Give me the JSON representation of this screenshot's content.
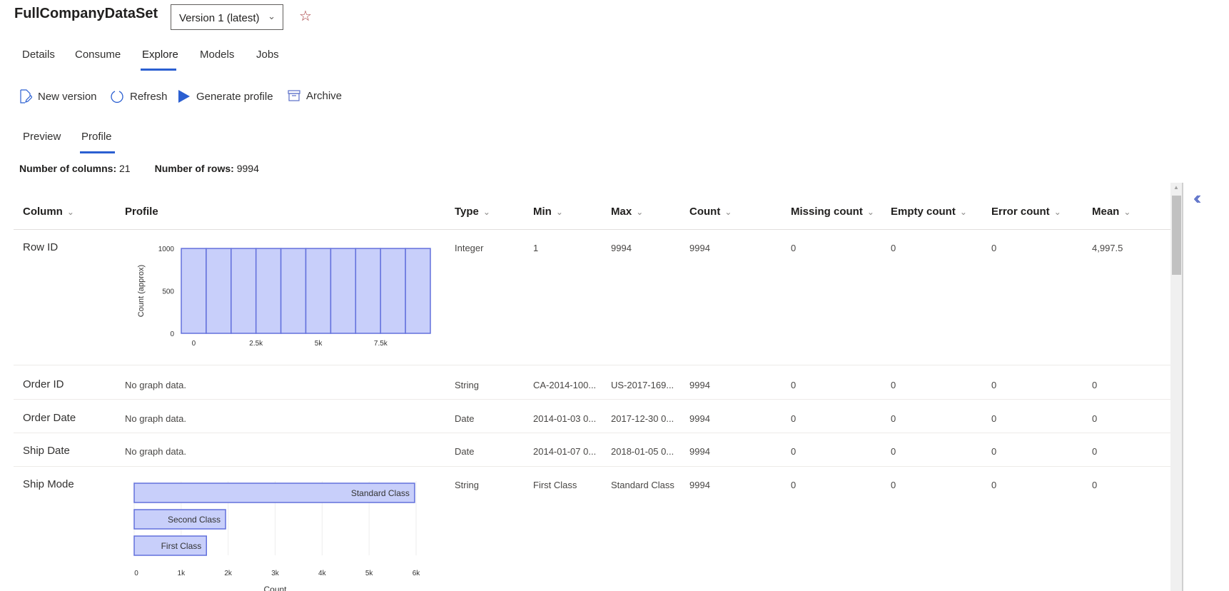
{
  "header": {
    "title": "FullCompanyDataSet",
    "version": "Version 1 (latest)"
  },
  "tabs": [
    "Details",
    "Consume",
    "Explore",
    "Models",
    "Jobs"
  ],
  "active_tab": "Explore",
  "toolbar": {
    "new_version": "New version",
    "refresh": "Refresh",
    "generate_profile": "Generate profile",
    "archive": "Archive"
  },
  "subtabs": [
    "Preview",
    "Profile"
  ],
  "active_subtab": "Profile",
  "stats": {
    "columns_label": "Number of columns:",
    "columns": "21",
    "rows_label": "Number of rows:",
    "rows": "9994"
  },
  "table": {
    "headers": [
      "Column",
      "Profile",
      "Type",
      "Min",
      "Max",
      "Count",
      "Missing count",
      "Empty count",
      "Error count",
      "Mean"
    ],
    "rows": [
      {
        "column": "Row ID",
        "profile": "",
        "type": "Integer",
        "min": "1",
        "max": "9994",
        "count": "9994",
        "missing": "0",
        "empty": "0",
        "error": "0",
        "mean": "4,997.5"
      },
      {
        "column": "Order ID",
        "profile": "No graph data.",
        "type": "String",
        "min": "CA-2014-100...",
        "max": "US-2017-169...",
        "count": "9994",
        "missing": "0",
        "empty": "0",
        "error": "0",
        "mean": "0"
      },
      {
        "column": "Order Date",
        "profile": "No graph data.",
        "type": "Date",
        "min": "2014-01-03 0...",
        "max": "2017-12-30 0...",
        "count": "9994",
        "missing": "0",
        "empty": "0",
        "error": "0",
        "mean": "0"
      },
      {
        "column": "Ship Date",
        "profile": "No graph data.",
        "type": "Date",
        "min": "2014-01-07 0...",
        "max": "2018-01-05 0...",
        "count": "9994",
        "missing": "0",
        "empty": "0",
        "error": "0",
        "mean": "0"
      },
      {
        "column": "Ship Mode",
        "profile": "",
        "type": "String",
        "min": "First Class",
        "max": "Standard Class",
        "count": "9994",
        "missing": "0",
        "empty": "0",
        "error": "0",
        "mean": "0"
      }
    ]
  },
  "chart_data": [
    {
      "type": "bar",
      "title": "Row ID histogram",
      "ylabel": "Count (approx)",
      "xlabel": "",
      "bin_start": -499,
      "bin_width": 999.3,
      "values": [
        999,
        999,
        999,
        999,
        999,
        999,
        999,
        999,
        999,
        999
      ],
      "ylim": [
        0,
        1000
      ],
      "yticks": [
        "0",
        "500",
        "1000"
      ],
      "yticks_values": [
        0,
        500,
        1000
      ],
      "xticks": [
        "0",
        "2.5k",
        "5k",
        "7.5k"
      ],
      "xticks_values": [
        0,
        2500,
        5000,
        7500
      ]
    },
    {
      "type": "bar",
      "orientation": "horizontal",
      "title": "Ship Mode",
      "xlabel": "Count",
      "categories": [
        "Standard Class",
        "Second Class",
        "First Class"
      ],
      "values": [
        5968,
        1945,
        1538
      ],
      "xlim": [
        0,
        6000
      ],
      "xticks": [
        "0",
        "1k",
        "2k",
        "3k",
        "4k",
        "5k",
        "6k"
      ],
      "xticks_values": [
        0,
        1000,
        2000,
        3000,
        4000,
        5000,
        6000
      ],
      "grid": true
    }
  ],
  "colors": {
    "accent": "#2b5fd1",
    "bar_fill": "#c8cffa",
    "bar_stroke": "#6270dc",
    "star": "#a4373a"
  }
}
